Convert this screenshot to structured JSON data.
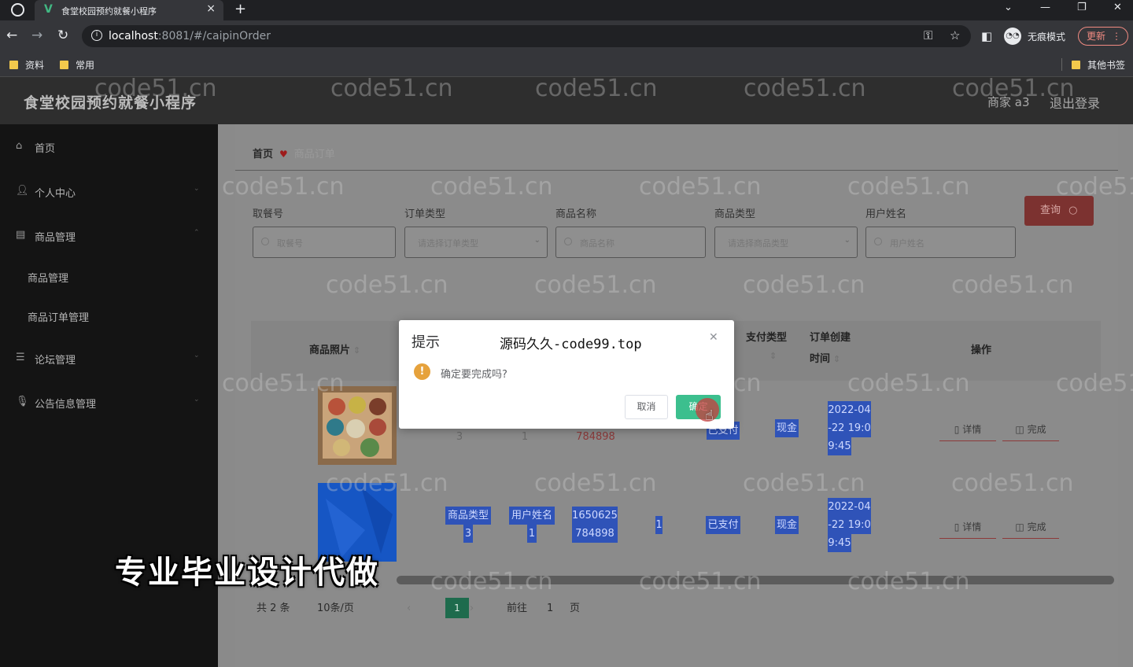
{
  "browser": {
    "tab_title": "食堂校园预约就餐小程序",
    "tab_close": "×",
    "new_tab": "+",
    "url_host": "localhost",
    "url_path": ":8081/#/caipinOrder",
    "incognito_label": "无痕模式",
    "update_label": "更新",
    "bookmarks": [
      "资料",
      "常用"
    ],
    "other_bookmarks": "其他书签"
  },
  "app": {
    "title": "食堂校园预约就餐小程序",
    "user_label": "商家 a3",
    "logout": "退出登录"
  },
  "sidebar": {
    "items": [
      {
        "label": "首页",
        "icon": "home-icon"
      },
      {
        "label": "个人中心",
        "icon": "user-icon"
      },
      {
        "label": "商品管理",
        "icon": "chat-icon"
      },
      {
        "label": "商品管理",
        "icon": ""
      },
      {
        "label": "商品订单管理",
        "icon": ""
      },
      {
        "label": "论坛管理",
        "icon": "list-icon"
      },
      {
        "label": "公告信息管理",
        "icon": "mic-icon"
      }
    ]
  },
  "breadcrumb": {
    "home": "首页",
    "current": "商品订单"
  },
  "filters": {
    "fields": [
      {
        "label": "取餐号",
        "placeholder": "取餐号"
      },
      {
        "label": "订单类型",
        "placeholder": "请选择订单类型"
      },
      {
        "label": "商品名称",
        "placeholder": "商品名称"
      },
      {
        "label": "商品类型",
        "placeholder": "请选择商品类型"
      },
      {
        "label": "用户姓名",
        "placeholder": "用户姓名"
      }
    ],
    "search_button": "查询"
  },
  "table": {
    "headers": {
      "photo": "商品照片",
      "pay_type": "支付类型",
      "created_line1": "订单创建",
      "created_line2": "时间",
      "actions": "操作"
    },
    "rows": [
      {
        "type_tail": "3",
        "user_tail": "1",
        "order_no_tail": "784898",
        "status": "已支付",
        "pay_type": "现金",
        "time": [
          "2022-04",
          "-22 19:0",
          "9:45"
        ],
        "detail": "详情",
        "finish": "完成"
      },
      {
        "type": [
          "商品类型",
          "3"
        ],
        "user": [
          "用户姓名",
          "1"
        ],
        "order_no": [
          "1650625",
          "784898"
        ],
        "qty": "1",
        "status": "已支付",
        "pay_type": "现金",
        "time": [
          "2022-04",
          "-22 19:0",
          "9:45"
        ],
        "detail": "详情",
        "finish": "完成"
      }
    ]
  },
  "pagination": {
    "total": "共 2 条",
    "page_size": "10条/页",
    "current_page": "1",
    "goto_prefix": "前往",
    "goto_value": "1",
    "goto_suffix": "页"
  },
  "watermark": "code51.cn",
  "overlay_text": "专业毕业设计代做",
  "dialog": {
    "title": "提示",
    "brand": "源码久久-code99.top",
    "message": "确定要完成吗?",
    "cancel": "取消",
    "confirm": "确定"
  },
  "colors": {
    "accent_green": "#3cbf8e",
    "warning": "#e6a23c",
    "search_red": "#7c3230"
  }
}
